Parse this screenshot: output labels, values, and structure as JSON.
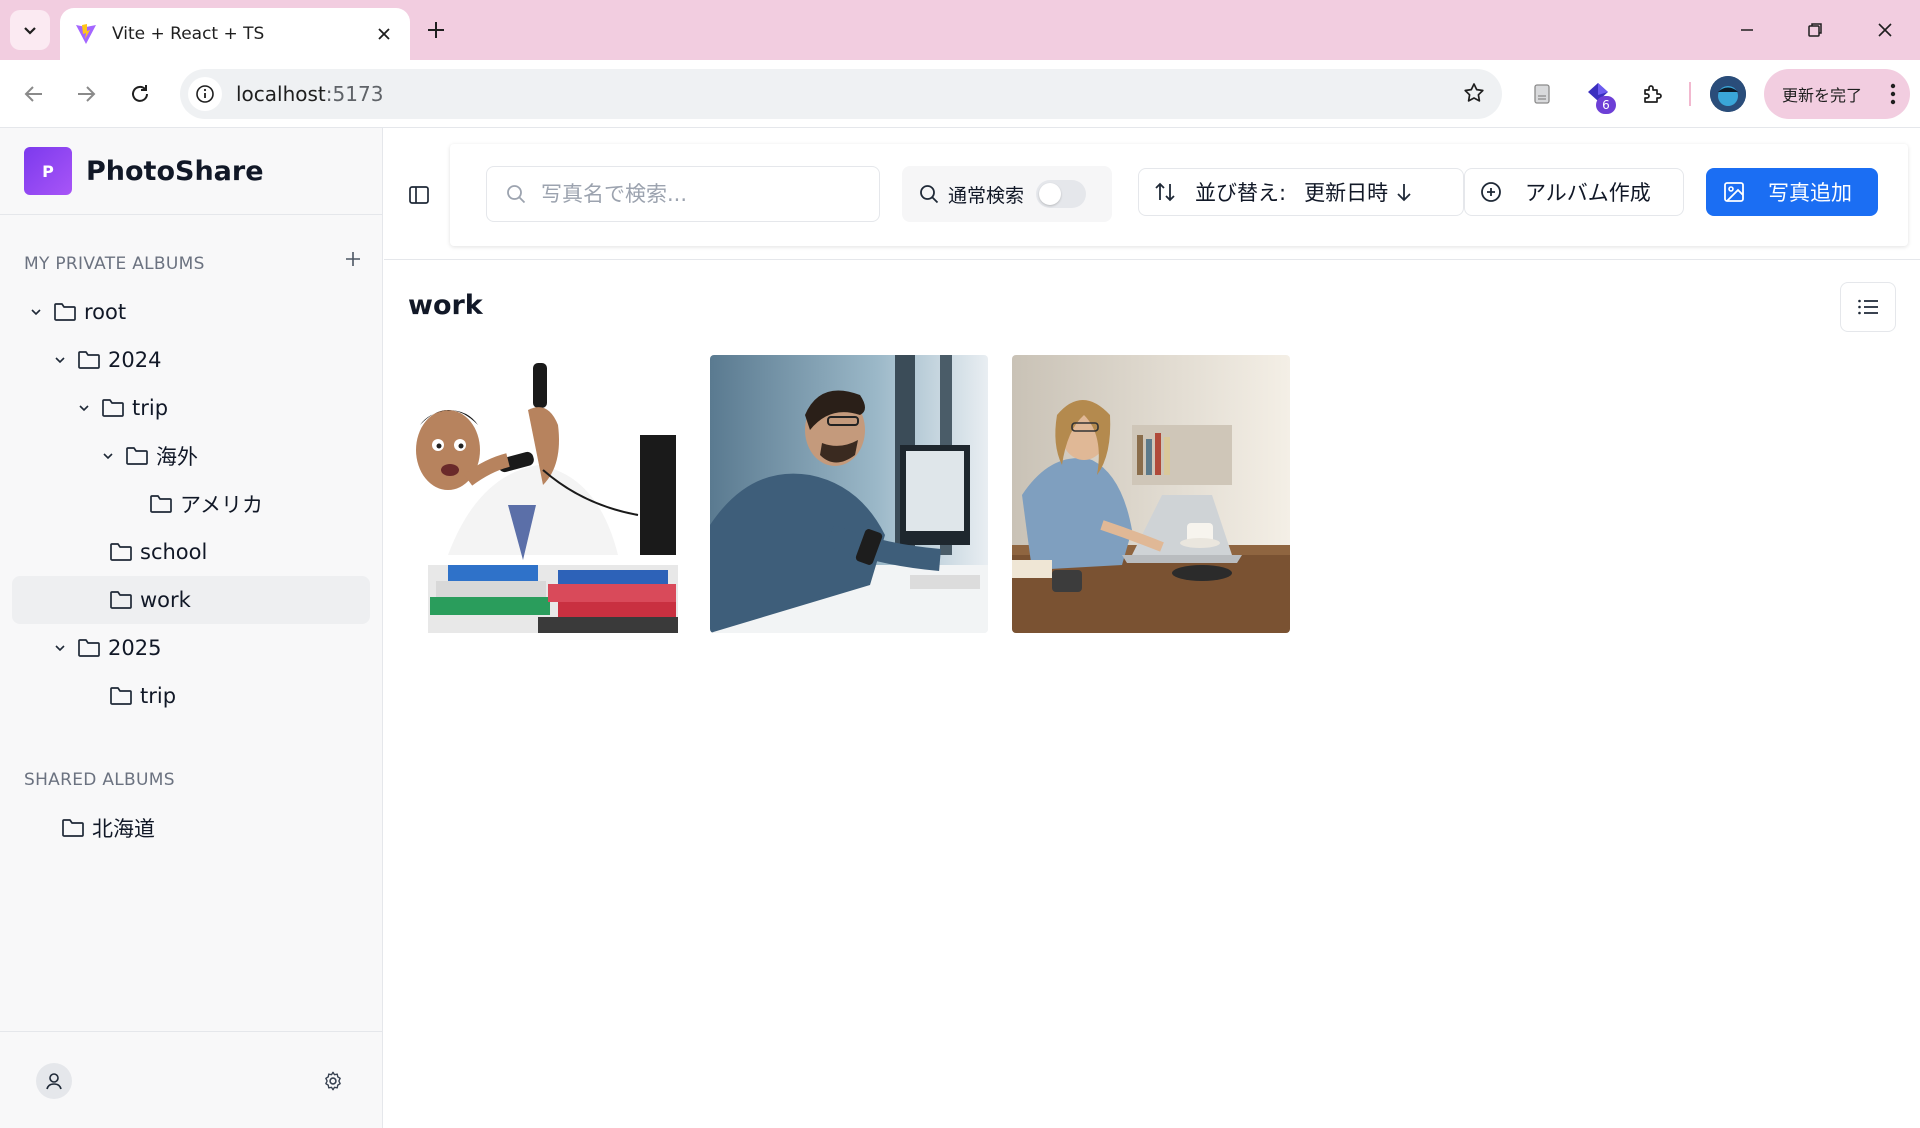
{
  "browser": {
    "tab_title": "Vite + React + TS",
    "url_host": "localhost",
    "url_port": ":5173",
    "extension_badge": "6",
    "update_label": "更新を完了"
  },
  "sidebar": {
    "brand_initial": "P",
    "brand_name": "PhotoShare",
    "private_title": "MY PRIVATE ALBUMS",
    "shared_title": "SHARED ALBUMS",
    "private_albums": [
      {
        "label": "root",
        "expanded": true
      },
      {
        "label": "2024",
        "expanded": true
      },
      {
        "label": "trip",
        "expanded": true
      },
      {
        "label": "海外",
        "expanded": true
      },
      {
        "label": "アメリカ"
      },
      {
        "label": "school"
      },
      {
        "label": "work",
        "selected": true
      },
      {
        "label": "2025",
        "expanded": true
      },
      {
        "label": "trip"
      }
    ],
    "shared_albums": [
      {
        "label": "北海道"
      }
    ]
  },
  "toolbar": {
    "search_placeholder": "写真名で検索...",
    "search_mode_label": "通常検索",
    "search_mode_on": false,
    "sort_label": "並び替え:",
    "sort_value": "更新日時",
    "create_album_label": "アルバム作成",
    "add_photo_label": "写真追加"
  },
  "main": {
    "album_title": "work",
    "photos": [
      {
        "icon": "stressed-man-phones-photo"
      },
      {
        "icon": "man-at-computer-photo"
      },
      {
        "icon": "woman-on-laptop-photo"
      }
    ]
  },
  "colors": {
    "accent": "#1b6ef3",
    "brand_gradient_start": "#7c3aed",
    "tabbar": "#f2cde0"
  }
}
